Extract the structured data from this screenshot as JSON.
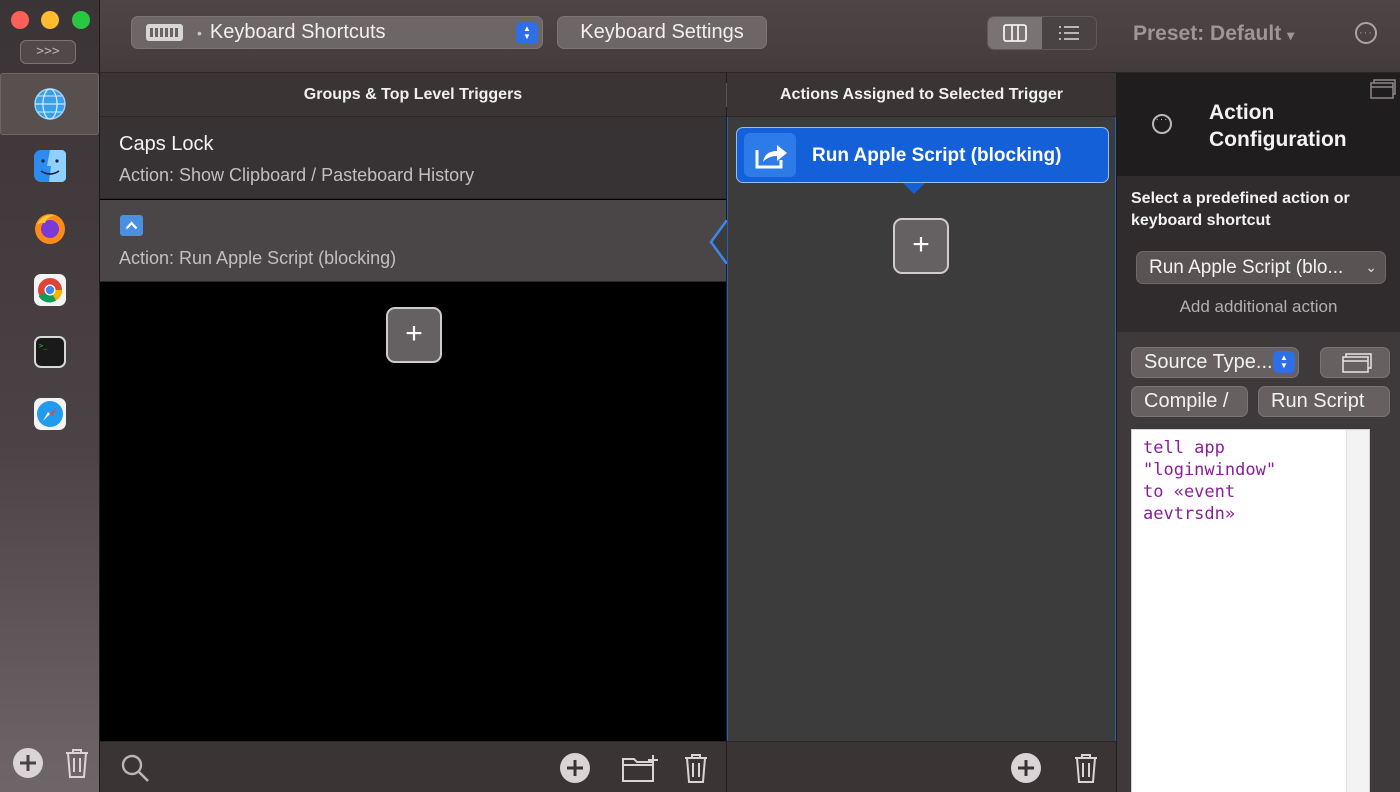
{
  "sidebar": {
    "expand_label": ">>>",
    "apps": [
      {
        "name": "global",
        "selected": true
      },
      {
        "name": "finder",
        "selected": false
      },
      {
        "name": "firefox",
        "selected": false
      },
      {
        "name": "chrome",
        "selected": false
      },
      {
        "name": "terminal",
        "selected": false
      },
      {
        "name": "safari",
        "selected": false
      }
    ]
  },
  "toolbar": {
    "trigger_type": "Keyboard Shortcuts",
    "settings_button": "Keyboard Settings",
    "preset_label": "Preset: Default",
    "preset_chevron": "▾",
    "view_modes": [
      "columns",
      "list"
    ],
    "active_view": "columns"
  },
  "triggers_panel": {
    "header": "Groups & Top Level Triggers",
    "rows": [
      {
        "title": "Caps Lock",
        "action": "Action: Show Clipboard / Pasteboard History",
        "selected": false
      },
      {
        "title": "",
        "key_symbol": "^",
        "action": "Action: Run Apple Script (blocking)",
        "selected": true
      }
    ],
    "add_label": "+"
  },
  "actions_panel": {
    "header": "Actions Assigned to Selected Trigger",
    "actions": [
      {
        "label": "Run Apple Script (blocking)"
      }
    ],
    "add_label": "+"
  },
  "config_panel": {
    "title": "Action Configuration",
    "prompt": "Select a predefined action or keyboard shortcut",
    "selected_action": "Run Apple Script (blo...",
    "add_additional": "Add additional action",
    "source_type": "Source Type...",
    "compile_label": "Compile /",
    "run_label": "Run Script",
    "script_lines": [
      "tell app",
      "\"loginwindow\"",
      "to «event",
      "aevtrsdn»"
    ]
  },
  "colors": {
    "accent": "#1360d8",
    "selection_border": "#2c5fa8",
    "script_text": "#8a1e9a"
  }
}
